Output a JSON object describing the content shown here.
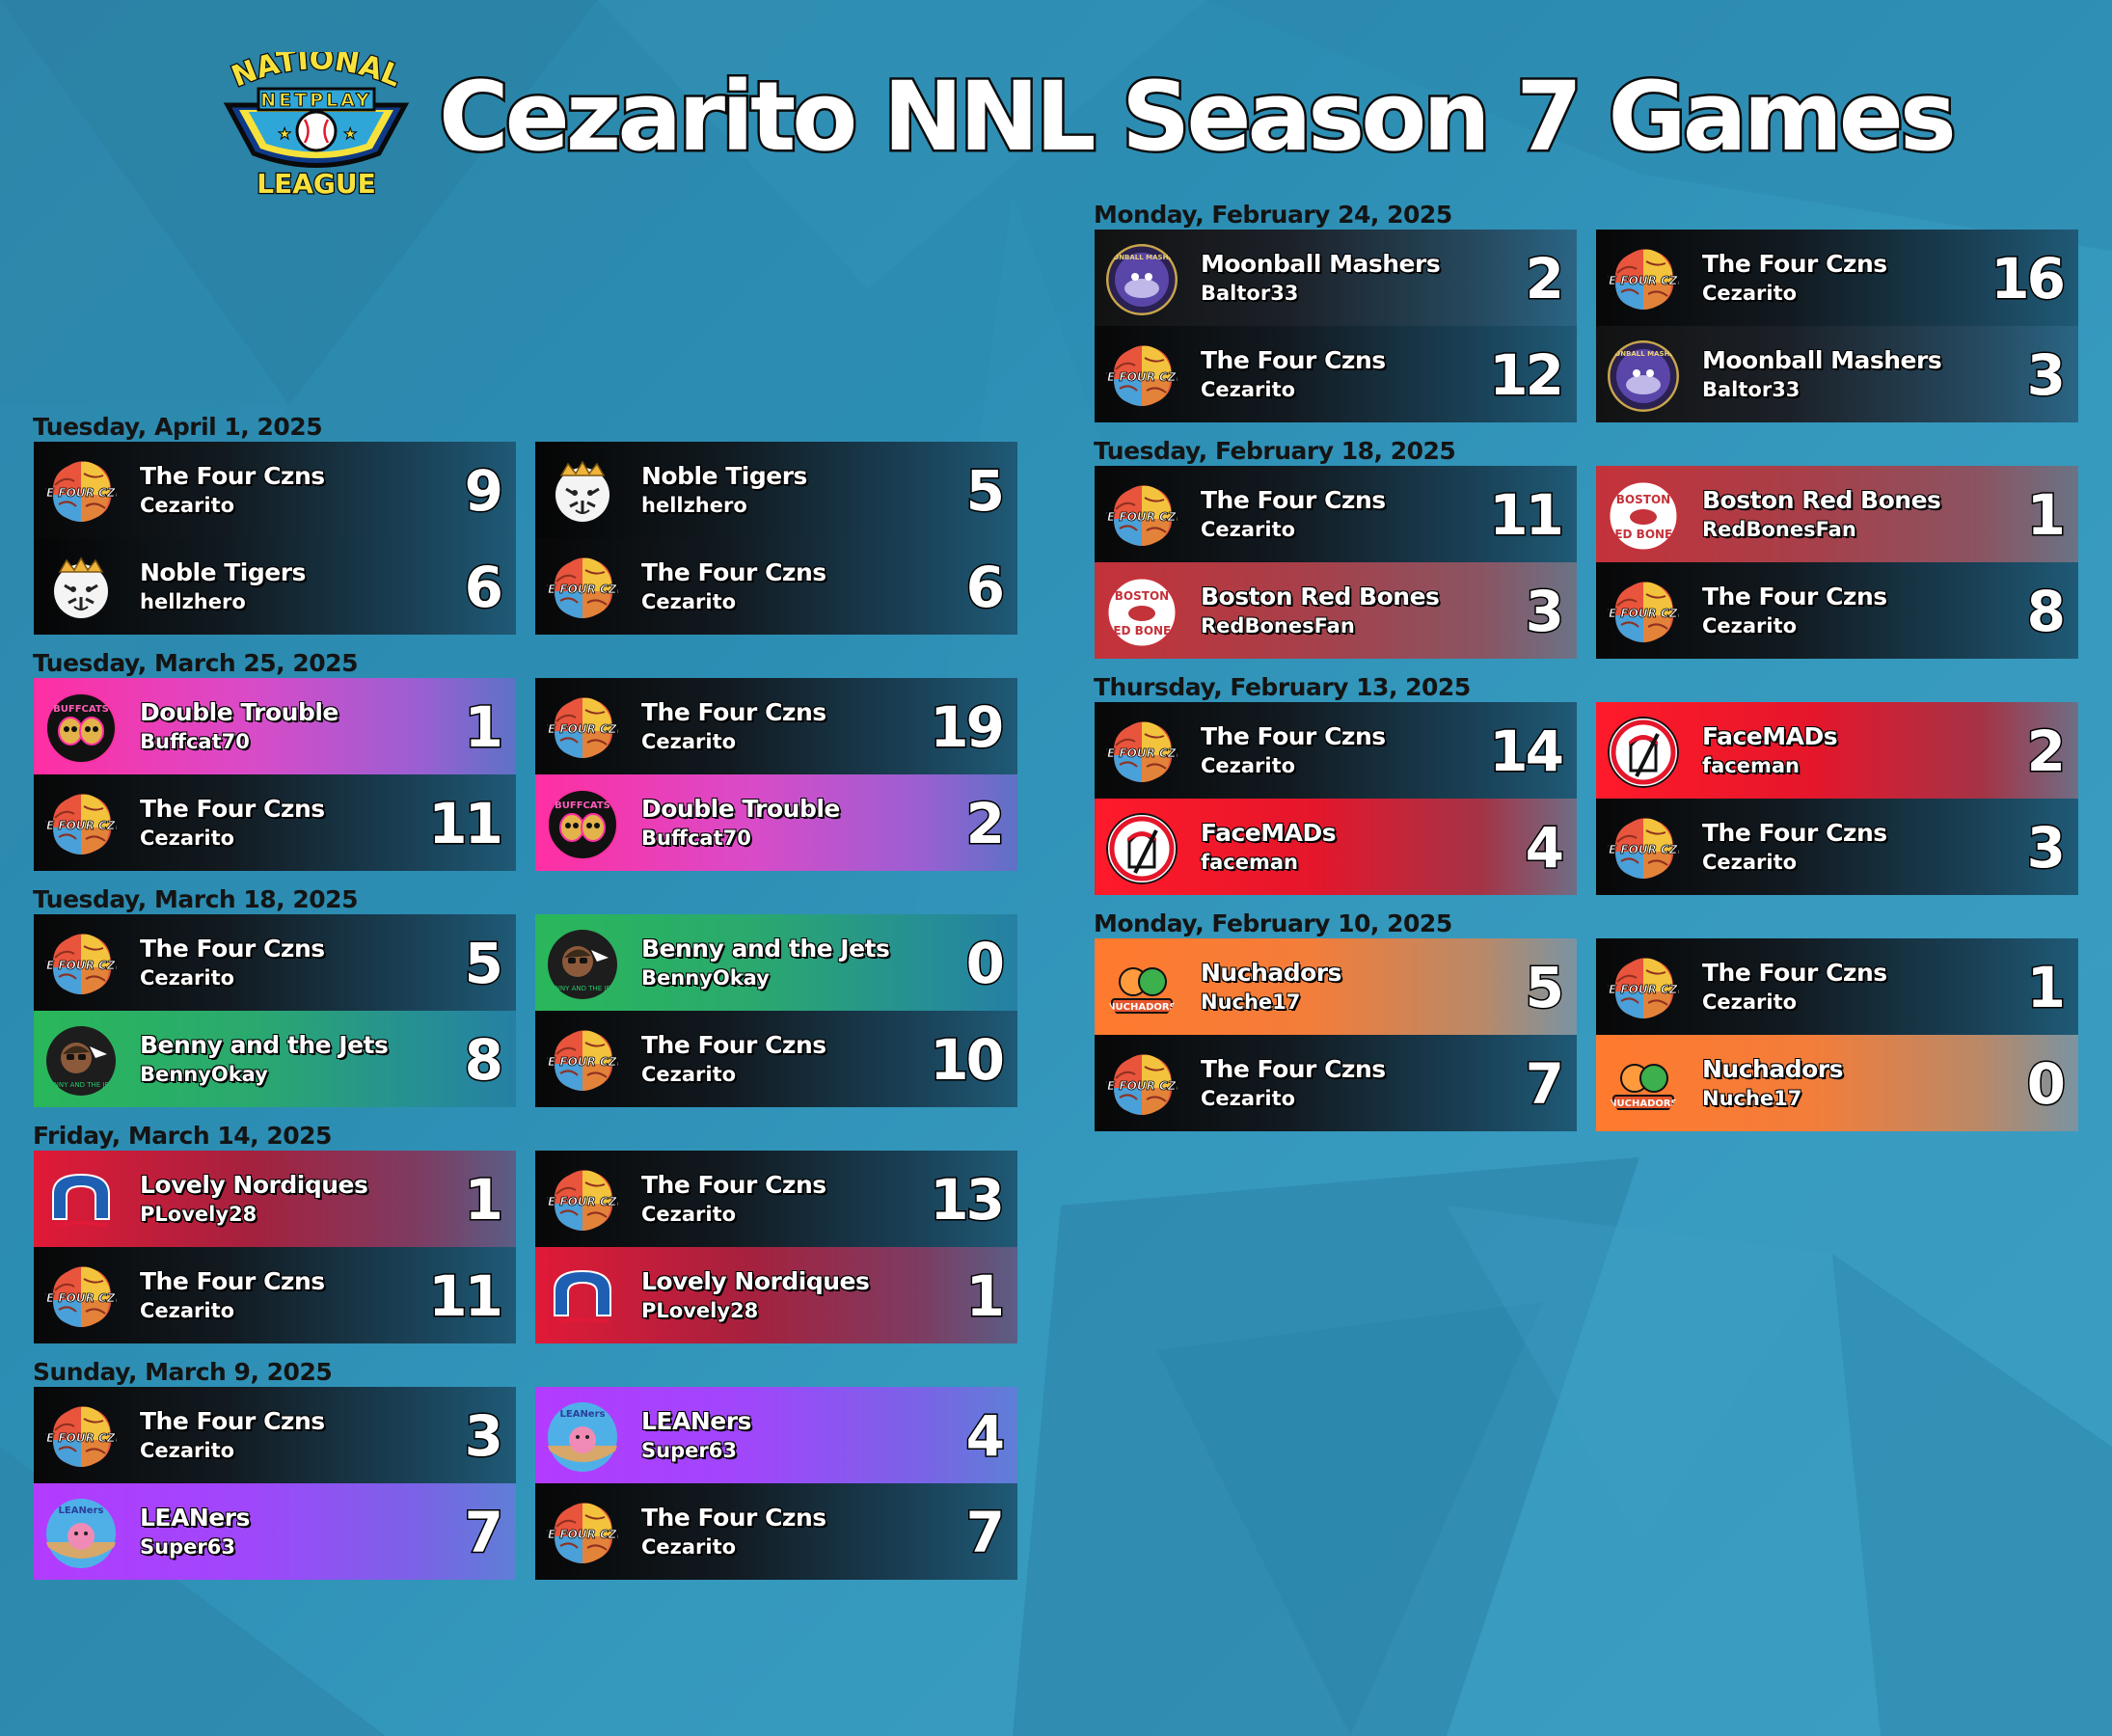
{
  "header": {
    "title": "Cezarito NNL Season 7 Games",
    "logo": {
      "line1": "NATIONAL",
      "line2": "NETPLAY",
      "line3": "LEAGUE"
    }
  },
  "colors": {
    "background": "#2c8db3",
    "title_text": "#ffffff",
    "title_outline": "#0c0c0c",
    "date_text": "#141414"
  },
  "left_column": [
    {
      "date": "Tuesday, April 1, 2025",
      "games": [
        [
          {
            "team": "The Four Czns",
            "player": "Cezarito",
            "score": "9",
            "style": "czns",
            "logo": "four-czns-logo"
          },
          {
            "team": "Noble Tigers",
            "player": "hellzhero",
            "score": "6",
            "style": "tigers",
            "logo": "noble-tigers-logo"
          }
        ],
        [
          {
            "team": "Noble Tigers",
            "player": "hellzhero",
            "score": "5",
            "style": "tigers",
            "logo": "noble-tigers-logo"
          },
          {
            "team": "The Four Czns",
            "player": "Cezarito",
            "score": "6",
            "style": "czns",
            "logo": "four-czns-logo"
          }
        ]
      ]
    },
    {
      "date": "Tuesday, March 25, 2025",
      "games": [
        [
          {
            "team": "Double Trouble",
            "player": "Buffcat70",
            "score": "1",
            "style": "trouble",
            "logo": "double-trouble-logo"
          },
          {
            "team": "The Four Czns",
            "player": "Cezarito",
            "score": "11",
            "style": "czns",
            "logo": "four-czns-logo"
          }
        ],
        [
          {
            "team": "The Four Czns",
            "player": "Cezarito",
            "score": "19",
            "style": "czns",
            "logo": "four-czns-logo"
          },
          {
            "team": "Double Trouble",
            "player": "Buffcat70",
            "score": "2",
            "style": "trouble",
            "logo": "double-trouble-logo"
          }
        ]
      ]
    },
    {
      "date": "Tuesday, March 18, 2025",
      "games": [
        [
          {
            "team": "The Four Czns",
            "player": "Cezarito",
            "score": "5",
            "style": "czns",
            "logo": "four-czns-logo"
          },
          {
            "team": "Benny and the Jets",
            "player": "BennyOkay",
            "score": "8",
            "style": "jets",
            "logo": "benny-jets-logo"
          }
        ],
        [
          {
            "team": "Benny and the Jets",
            "player": "BennyOkay",
            "score": "0",
            "style": "jets",
            "logo": "benny-jets-logo"
          },
          {
            "team": "The Four Czns",
            "player": "Cezarito",
            "score": "10",
            "style": "czns",
            "logo": "four-czns-logo"
          }
        ]
      ]
    },
    {
      "date": "Friday, March 14, 2025",
      "games": [
        [
          {
            "team": "Lovely Nordiques",
            "player": "PLovely28",
            "score": "1",
            "style": "nordiques",
            "logo": "lovely-nordiques-logo"
          },
          {
            "team": "The Four Czns",
            "player": "Cezarito",
            "score": "11",
            "style": "czns",
            "logo": "four-czns-logo"
          }
        ],
        [
          {
            "team": "The Four Czns",
            "player": "Cezarito",
            "score": "13",
            "style": "czns",
            "logo": "four-czns-logo"
          },
          {
            "team": "Lovely Nordiques",
            "player": "PLovely28",
            "score": "1",
            "style": "nordiques",
            "logo": "lovely-nordiques-logo"
          }
        ]
      ]
    },
    {
      "date": "Sunday, March 9, 2025",
      "games": [
        [
          {
            "team": "The Four Czns",
            "player": "Cezarito",
            "score": "3",
            "style": "czns",
            "logo": "four-czns-logo"
          },
          {
            "team": "LEANers",
            "player": "Super63",
            "score": "7",
            "style": "leaners",
            "logo": "leaners-logo"
          }
        ],
        [
          {
            "team": "LEANers",
            "player": "Super63",
            "score": "4",
            "style": "leaners",
            "logo": "leaners-logo"
          },
          {
            "team": "The Four Czns",
            "player": "Cezarito",
            "score": "7",
            "style": "czns",
            "logo": "four-czns-logo"
          }
        ]
      ]
    }
  ],
  "right_column": [
    {
      "date": "Monday, February 24, 2025",
      "games": [
        [
          {
            "team": "Moonball Mashers",
            "player": "Baltor33",
            "score": "2",
            "style": "mashers",
            "logo": "moonball-mashers-logo"
          },
          {
            "team": "The Four Czns",
            "player": "Cezarito",
            "score": "12",
            "style": "czns",
            "logo": "four-czns-logo"
          }
        ],
        [
          {
            "team": "The Four Czns",
            "player": "Cezarito",
            "score": "16",
            "style": "czns",
            "logo": "four-czns-logo"
          },
          {
            "team": "Moonball Mashers",
            "player": "Baltor33",
            "score": "3",
            "style": "mashers",
            "logo": "moonball-mashers-logo"
          }
        ]
      ]
    },
    {
      "date": "Tuesday, February 18, 2025",
      "games": [
        [
          {
            "team": "The Four Czns",
            "player": "Cezarito",
            "score": "11",
            "style": "czns",
            "logo": "four-czns-logo"
          },
          {
            "team": "Boston Red Bones",
            "player": "RedBonesFan",
            "score": "3",
            "style": "boston",
            "logo": "boston-red-bones-logo"
          }
        ],
        [
          {
            "team": "Boston Red Bones",
            "player": "RedBonesFan",
            "score": "1",
            "style": "boston",
            "logo": "boston-red-bones-logo"
          },
          {
            "team": "The Four Czns",
            "player": "Cezarito",
            "score": "8",
            "style": "czns",
            "logo": "four-czns-logo"
          }
        ]
      ]
    },
    {
      "date": "Thursday, February 13, 2025",
      "games": [
        [
          {
            "team": "The Four Czns",
            "player": "Cezarito",
            "score": "14",
            "style": "czns",
            "logo": "four-czns-logo"
          },
          {
            "team": "FaceMADs",
            "player": "faceman",
            "score": "4",
            "style": "facemads",
            "logo": "facemads-logo"
          }
        ],
        [
          {
            "team": "FaceMADs",
            "player": "faceman",
            "score": "2",
            "style": "facemads",
            "logo": "facemads-logo"
          },
          {
            "team": "The Four Czns",
            "player": "Cezarito",
            "score": "3",
            "style": "czns",
            "logo": "four-czns-logo"
          }
        ]
      ]
    },
    {
      "date": "Monday, February 10, 2025",
      "games": [
        [
          {
            "team": "Nuchadors",
            "player": "Nuche17",
            "score": "5",
            "style": "nuchadors",
            "logo": "nuchadors-logo"
          },
          {
            "team": "The Four Czns",
            "player": "Cezarito",
            "score": "7",
            "style": "czns",
            "logo": "four-czns-logo"
          }
        ],
        [
          {
            "team": "The Four Czns",
            "player": "Cezarito",
            "score": "1",
            "style": "czns",
            "logo": "four-czns-logo"
          },
          {
            "team": "Nuchadors",
            "player": "Nuche17",
            "score": "0",
            "style": "nuchadors",
            "logo": "nuchadors-logo"
          }
        ]
      ]
    }
  ]
}
